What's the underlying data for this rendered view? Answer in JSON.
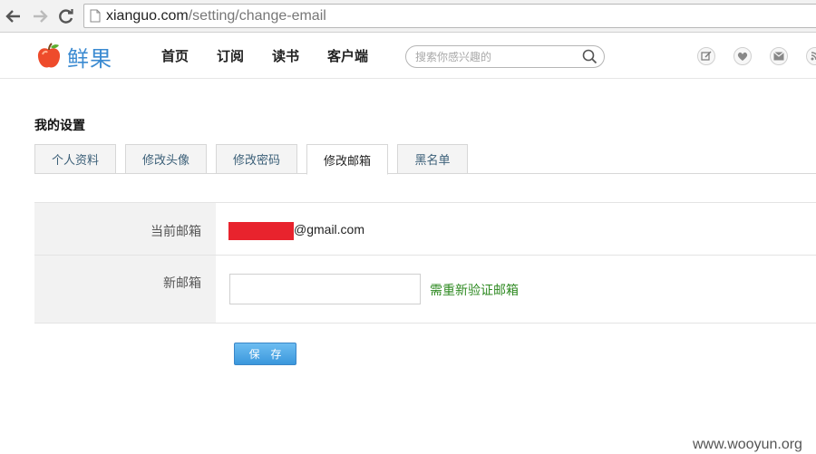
{
  "browser": {
    "url_domain": "xianguo.com",
    "url_path": "/setting/change-email"
  },
  "site": {
    "logo_text": "鲜果",
    "nav": [
      "首页",
      "订阅",
      "读书",
      "客户端"
    ],
    "search_placeholder": "搜索你感兴趣的"
  },
  "settings": {
    "title": "我的设置",
    "tabs": [
      {
        "label": "个人资料",
        "active": false
      },
      {
        "label": "修改头像",
        "active": false
      },
      {
        "label": "修改密码",
        "active": false
      },
      {
        "label": "修改邮箱",
        "active": true
      },
      {
        "label": "黑名单",
        "active": false
      }
    ],
    "current_email_label": "当前邮箱",
    "current_email_domain": "@gmail.com",
    "new_email_label": "新邮箱",
    "new_email_value": "",
    "verify_hint": "需重新验证邮箱",
    "save_label": "保 存"
  },
  "watermark": "www.wooyun.org",
  "colors": {
    "accent_blue": "#3a97dc",
    "hint_green": "#2f8a22",
    "redaction": "#e8232d"
  }
}
